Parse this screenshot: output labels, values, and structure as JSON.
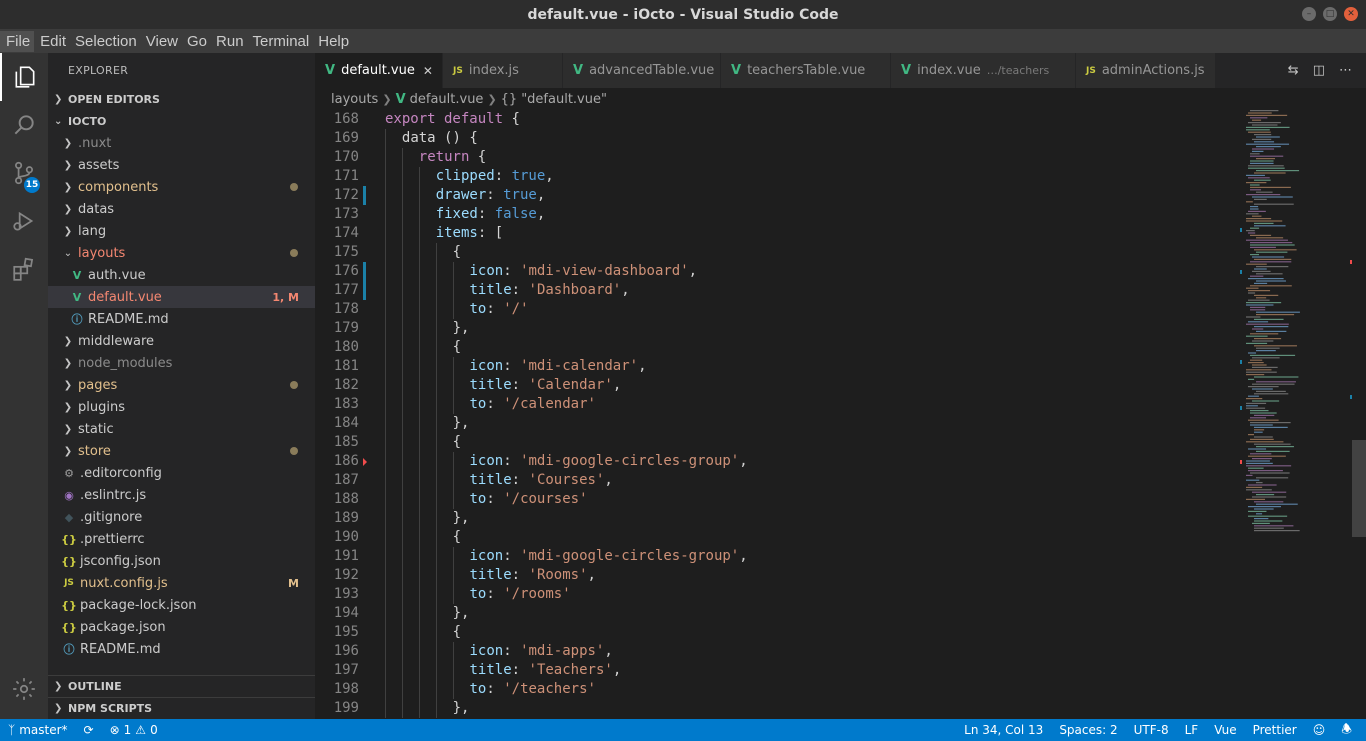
{
  "window": {
    "title": "default.vue - iOcto - Visual Studio Code"
  },
  "menu": [
    "File",
    "Edit",
    "Selection",
    "View",
    "Go",
    "Run",
    "Terminal",
    "Help"
  ],
  "activity": {
    "scm_badge": "15"
  },
  "sidebar": {
    "title": "EXPLORER",
    "open_editors": "OPEN EDITORS",
    "project": "IOCTO",
    "outline": "OUTLINE",
    "npm_scripts": "NPM SCRIPTS",
    "tree": [
      {
        "label": ".nuxt",
        "kind": "folder",
        "state": "dim"
      },
      {
        "label": "assets",
        "kind": "folder"
      },
      {
        "label": "components",
        "kind": "folder",
        "state": "mod",
        "dot": true
      },
      {
        "label": "datas",
        "kind": "folder"
      },
      {
        "label": "lang",
        "kind": "folder"
      },
      {
        "label": "layouts",
        "kind": "folder-open",
        "state": "err",
        "dot": true
      },
      {
        "label": "auth.vue",
        "kind": "vue",
        "indent": 1
      },
      {
        "label": "default.vue",
        "kind": "vue",
        "indent": 1,
        "state": "err",
        "deco": "1, M",
        "selected": true
      },
      {
        "label": "README.md",
        "kind": "info",
        "indent": 1
      },
      {
        "label": "middleware",
        "kind": "folder"
      },
      {
        "label": "node_modules",
        "kind": "folder",
        "state": "dim"
      },
      {
        "label": "pages",
        "kind": "folder",
        "state": "mod",
        "dot": true
      },
      {
        "label": "plugins",
        "kind": "folder"
      },
      {
        "label": "static",
        "kind": "folder"
      },
      {
        "label": "store",
        "kind": "folder",
        "state": "mod",
        "dot": true
      },
      {
        "label": ".editorconfig",
        "kind": "gear"
      },
      {
        "label": ".eslintrc.js",
        "kind": "eslint"
      },
      {
        "label": ".gitignore",
        "kind": "git"
      },
      {
        "label": ".prettierrc",
        "kind": "json"
      },
      {
        "label": "jsconfig.json",
        "kind": "json"
      },
      {
        "label": "nuxt.config.js",
        "kind": "js",
        "state": "mod",
        "deco": "M"
      },
      {
        "label": "package-lock.json",
        "kind": "json"
      },
      {
        "label": "package.json",
        "kind": "json"
      },
      {
        "label": "README.md",
        "kind": "info"
      }
    ]
  },
  "tabs": [
    {
      "label": "default.vue",
      "icon": "vue",
      "active": true
    },
    {
      "label": "index.js",
      "icon": "js"
    },
    {
      "label": "advancedTable.vue",
      "icon": "vue"
    },
    {
      "label": "teachersTable.vue",
      "icon": "vue"
    },
    {
      "label": "index.vue",
      "icon": "vue",
      "sub": "…/teachers"
    },
    {
      "label": "adminActions.js",
      "icon": "js"
    }
  ],
  "breadcrumb": {
    "folder": "layouts",
    "file": "default.vue",
    "symbol": "\"default.vue\""
  },
  "code": [
    {
      "n": "168",
      "indent": 0,
      "tokens": [
        [
          "k",
          "export default"
        ],
        [
          "d",
          " {"
        ]
      ]
    },
    {
      "n": "169",
      "indent": 1,
      "tokens": [
        [
          "d",
          "data () {"
        ]
      ]
    },
    {
      "n": "170",
      "indent": 2,
      "tokens": [
        [
          "k",
          "return"
        ],
        [
          "d",
          " {"
        ]
      ]
    },
    {
      "n": "171",
      "indent": 3,
      "tokens": [
        [
          "p",
          "clipped"
        ],
        [
          "d",
          ": "
        ],
        [
          "kb",
          "true"
        ],
        [
          "d",
          ","
        ]
      ]
    },
    {
      "n": "172",
      "indent": 3,
      "mod": true,
      "tokens": [
        [
          "p",
          "drawer"
        ],
        [
          "d",
          ": "
        ],
        [
          "kb",
          "true"
        ],
        [
          "d",
          ","
        ]
      ]
    },
    {
      "n": "173",
      "indent": 3,
      "tokens": [
        [
          "p",
          "fixed"
        ],
        [
          "d",
          ": "
        ],
        [
          "kb",
          "false"
        ],
        [
          "d",
          ","
        ]
      ]
    },
    {
      "n": "174",
      "indent": 3,
      "tokens": [
        [
          "p",
          "items"
        ],
        [
          "d",
          ": ["
        ]
      ]
    },
    {
      "n": "175",
      "indent": 4,
      "tokens": [
        [
          "d",
          "{"
        ]
      ]
    },
    {
      "n": "176",
      "indent": 5,
      "mod": true,
      "tokens": [
        [
          "p",
          "icon"
        ],
        [
          "d",
          ": "
        ],
        [
          "s",
          "'mdi-view-dashboard'"
        ],
        [
          "d",
          ","
        ]
      ]
    },
    {
      "n": "177",
      "indent": 5,
      "mod": true,
      "tokens": [
        [
          "p",
          "title"
        ],
        [
          "d",
          ": "
        ],
        [
          "s",
          "'Dashboard'"
        ],
        [
          "d",
          ","
        ]
      ]
    },
    {
      "n": "178",
      "indent": 5,
      "tokens": [
        [
          "p",
          "to"
        ],
        [
          "d",
          ": "
        ],
        [
          "s",
          "'/'"
        ]
      ]
    },
    {
      "n": "179",
      "indent": 4,
      "tokens": [
        [
          "d",
          "},"
        ]
      ]
    },
    {
      "n": "180",
      "indent": 4,
      "tokens": [
        [
          "d",
          "{"
        ]
      ]
    },
    {
      "n": "181",
      "indent": 5,
      "tokens": [
        [
          "p",
          "icon"
        ],
        [
          "d",
          ": "
        ],
        [
          "s",
          "'mdi-calendar'"
        ],
        [
          "d",
          ","
        ]
      ]
    },
    {
      "n": "182",
      "indent": 5,
      "tokens": [
        [
          "p",
          "title"
        ],
        [
          "d",
          ": "
        ],
        [
          "s",
          "'Calendar'"
        ],
        [
          "d",
          ","
        ]
      ]
    },
    {
      "n": "183",
      "indent": 5,
      "tokens": [
        [
          "p",
          "to"
        ],
        [
          "d",
          ": "
        ],
        [
          "s",
          "'/calendar'"
        ]
      ]
    },
    {
      "n": "184",
      "indent": 4,
      "tokens": [
        [
          "d",
          "},"
        ]
      ]
    },
    {
      "n": "185",
      "indent": 4,
      "tokens": [
        [
          "d",
          "{"
        ]
      ]
    },
    {
      "n": "186",
      "indent": 5,
      "del": true,
      "tokens": [
        [
          "p",
          "icon"
        ],
        [
          "d",
          ": "
        ],
        [
          "s",
          "'mdi-google-circles-group'"
        ],
        [
          "d",
          ","
        ]
      ]
    },
    {
      "n": "187",
      "indent": 5,
      "tokens": [
        [
          "p",
          "title"
        ],
        [
          "d",
          ": "
        ],
        [
          "s",
          "'Courses'"
        ],
        [
          "d",
          ","
        ]
      ]
    },
    {
      "n": "188",
      "indent": 5,
      "tokens": [
        [
          "p",
          "to"
        ],
        [
          "d",
          ": "
        ],
        [
          "s",
          "'/courses'"
        ]
      ]
    },
    {
      "n": "189",
      "indent": 4,
      "tokens": [
        [
          "d",
          "},"
        ]
      ]
    },
    {
      "n": "190",
      "indent": 4,
      "tokens": [
        [
          "d",
          "{"
        ]
      ]
    },
    {
      "n": "191",
      "indent": 5,
      "tokens": [
        [
          "p",
          "icon"
        ],
        [
          "d",
          ": "
        ],
        [
          "s",
          "'mdi-google-circles-group'"
        ],
        [
          "d",
          ","
        ]
      ]
    },
    {
      "n": "192",
      "indent": 5,
      "tokens": [
        [
          "p",
          "title"
        ],
        [
          "d",
          ": "
        ],
        [
          "s",
          "'Rooms'"
        ],
        [
          "d",
          ","
        ]
      ]
    },
    {
      "n": "193",
      "indent": 5,
      "tokens": [
        [
          "p",
          "to"
        ],
        [
          "d",
          ": "
        ],
        [
          "s",
          "'/rooms'"
        ]
      ]
    },
    {
      "n": "194",
      "indent": 4,
      "tokens": [
        [
          "d",
          "},"
        ]
      ]
    },
    {
      "n": "195",
      "indent": 4,
      "tokens": [
        [
          "d",
          "{"
        ]
      ]
    },
    {
      "n": "196",
      "indent": 5,
      "tokens": [
        [
          "p",
          "icon"
        ],
        [
          "d",
          ": "
        ],
        [
          "s",
          "'mdi-apps'"
        ],
        [
          "d",
          ","
        ]
      ]
    },
    {
      "n": "197",
      "indent": 5,
      "tokens": [
        [
          "p",
          "title"
        ],
        [
          "d",
          ": "
        ],
        [
          "s",
          "'Teachers'"
        ],
        [
          "d",
          ","
        ]
      ]
    },
    {
      "n": "198",
      "indent": 5,
      "tokens": [
        [
          "p",
          "to"
        ],
        [
          "d",
          ": "
        ],
        [
          "s",
          "'/teachers'"
        ]
      ]
    },
    {
      "n": "199",
      "indent": 4,
      "tokens": [
        [
          "d",
          "},"
        ]
      ]
    }
  ],
  "status": {
    "branch": "master*",
    "errors": "1",
    "warnings": "0",
    "position": "Ln 34, Col 13",
    "spaces": "Spaces: 2",
    "encoding": "UTF-8",
    "eol": "LF",
    "language": "Vue",
    "formatter": "Prettier"
  },
  "colors": {
    "accent": "#007acc",
    "modified": "#e2c08d",
    "error": "#f48771",
    "vue": "#41b883"
  }
}
